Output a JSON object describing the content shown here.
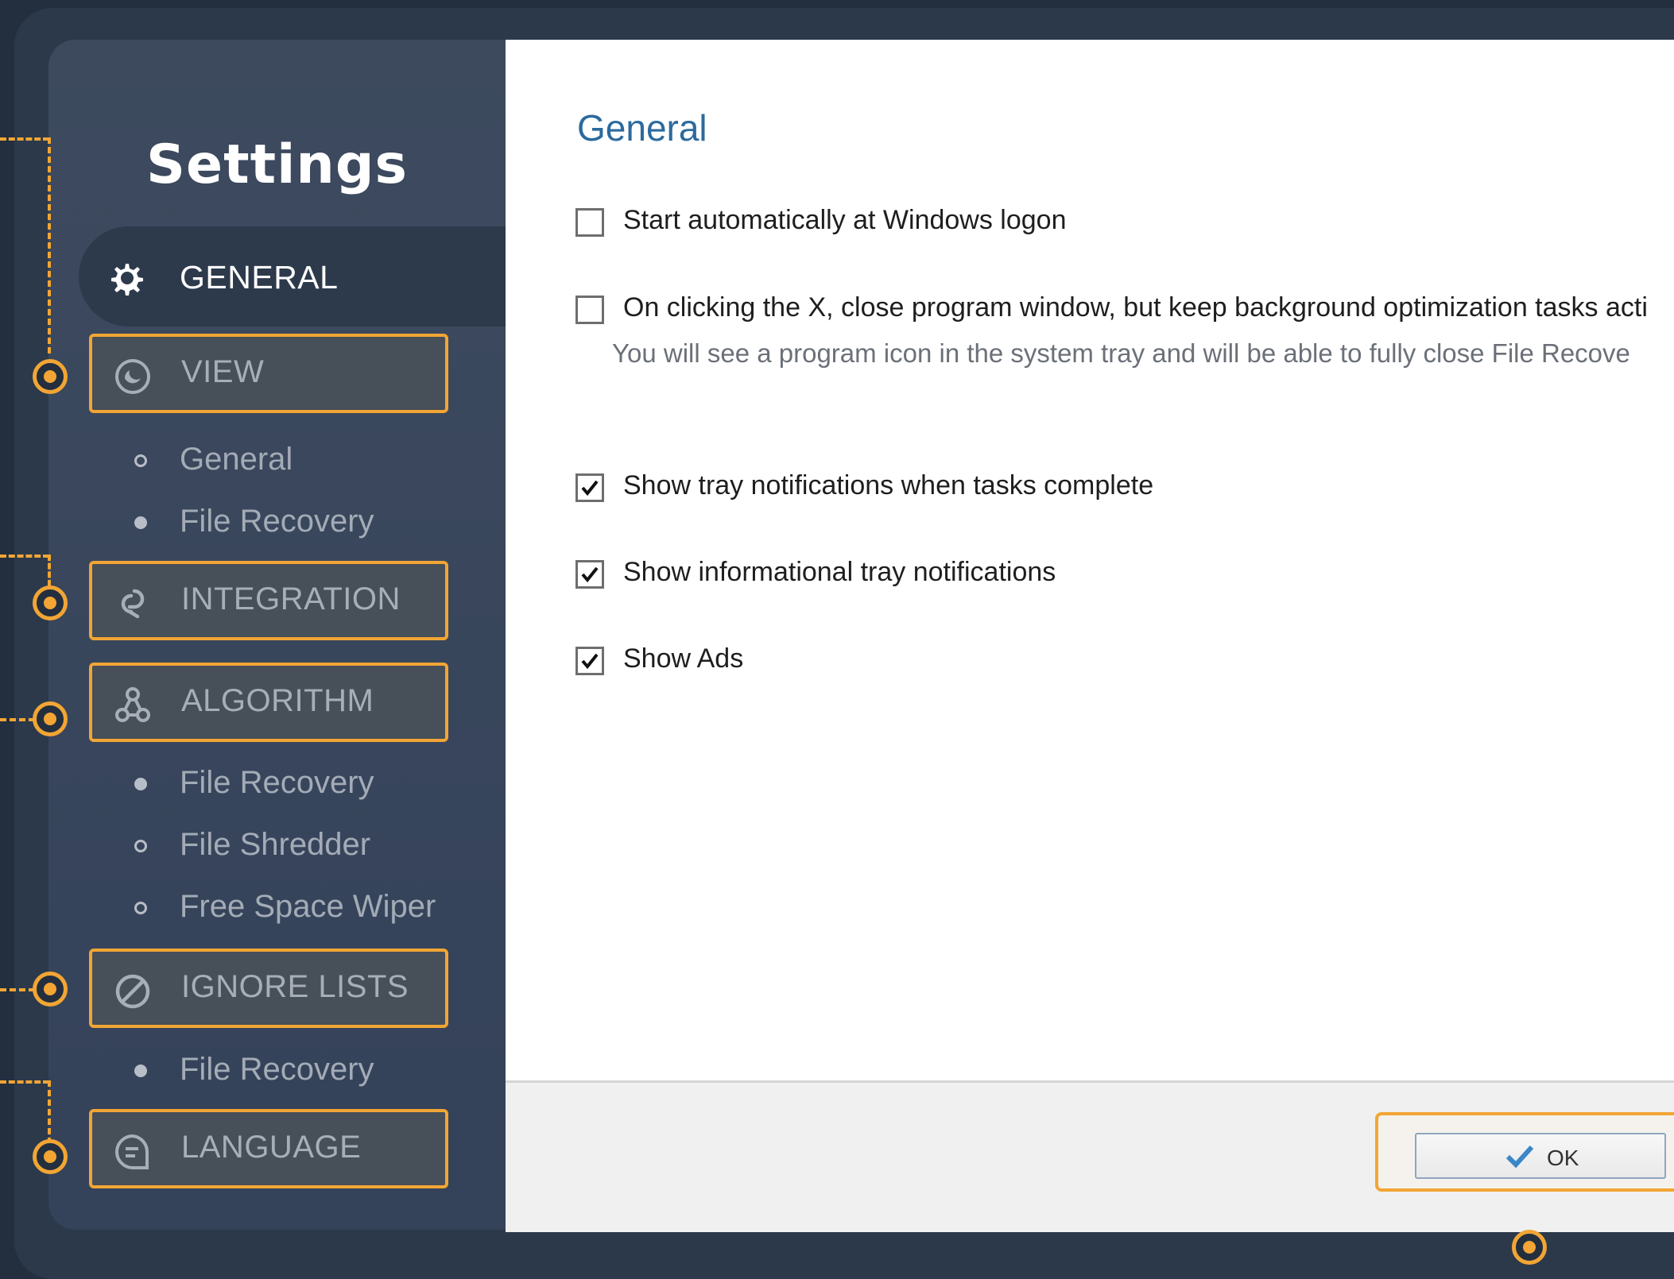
{
  "sidebar": {
    "title": "Settings",
    "active_item": {
      "label": "GENERAL",
      "icon": "gear-icon"
    },
    "items": [
      {
        "label": "VIEW",
        "icon": "view-icon"
      },
      {
        "label": "INTEGRATION",
        "icon": "link-icon"
      },
      {
        "label": "ALGORITHM",
        "icon": "algorithm-icon"
      },
      {
        "label": "IGNORE LISTS",
        "icon": "block-icon"
      },
      {
        "label": "LANGUAGE",
        "icon": "language-icon"
      }
    ],
    "view_subitems": [
      {
        "label": "General",
        "bullet": "hollow"
      },
      {
        "label": "File Recovery",
        "bullet": "filled"
      }
    ],
    "algorithm_subitems": [
      {
        "label": "File Recovery",
        "bullet": "filled"
      },
      {
        "label": "File Shredder",
        "bullet": "hollow"
      },
      {
        "label": "Free Space Wiper",
        "bullet": "hollow"
      }
    ],
    "ignore_subitems": [
      {
        "label": "File Recovery",
        "bullet": "filled"
      }
    ]
  },
  "content": {
    "title": "General",
    "options": [
      {
        "label": "Start automatically at Windows logon",
        "checked": false
      },
      {
        "label": "On clicking the X, close program window, but keep background optimization tasks acti",
        "checked": false,
        "description": "You will see a program icon in the system tray and will be able to fully close File Recove"
      },
      {
        "label": "Show tray notifications when tasks complete",
        "checked": true
      },
      {
        "label": "Show informational tray notifications",
        "checked": true
      },
      {
        "label": "Show Ads",
        "checked": true
      }
    ]
  },
  "footer": {
    "ok_label": "OK"
  },
  "colors": {
    "accent": "#f2a534",
    "sidebar_bg": "#3d4a5e",
    "title_blue": "#2c6a9e"
  }
}
